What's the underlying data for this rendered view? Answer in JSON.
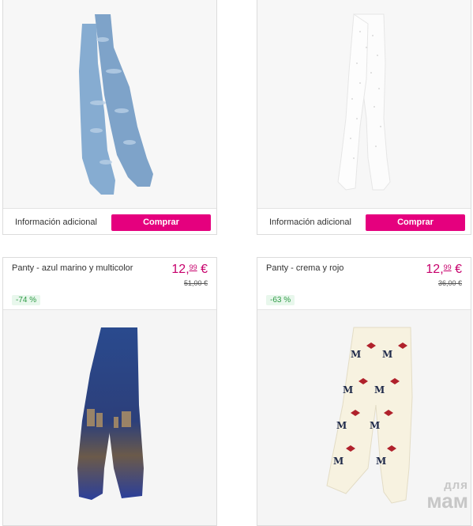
{
  "products": [
    {
      "info_label": "Información adicional",
      "buy_label": "Comprar",
      "image": "blue patterned tights"
    },
    {
      "info_label": "Información adicional",
      "buy_label": "Comprar",
      "image": "white dotted tights"
    },
    {
      "title": "Panty - azul marino y multicolor",
      "price_main": "12,",
      "price_cents": "99",
      "price_currency": " €",
      "old_price": "51,00 €",
      "discount": "-74 %",
      "image": "navy city print tights"
    },
    {
      "title": "Panty - crema y rojo",
      "price_main": "12,",
      "price_cents": "99",
      "price_currency": " €",
      "old_price": "36,00 €",
      "discount": "-63 %",
      "image": "cream tights with M and bows"
    }
  ],
  "watermark": {
    "line1": "для",
    "line2": "мам"
  },
  "colors": {
    "accent": "#e5007e",
    "price": "#c7006c",
    "badge_bg": "#e8f7ec",
    "badge_text": "#2e9a45"
  }
}
